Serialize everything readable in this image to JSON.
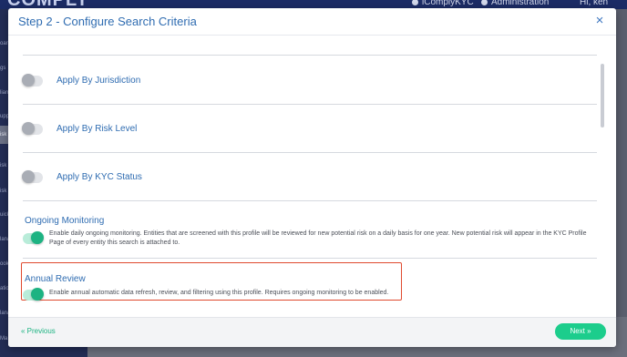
{
  "app": {
    "brand": "COMPLY",
    "org": "iComplyKYC",
    "admin": "Administration",
    "user": "Hi, ken"
  },
  "nav": {
    "items": [
      "oar",
      "gs",
      "lian",
      "upp",
      "isk S",
      "isk",
      "isk",
      "uick",
      "lana",
      "ook",
      "atio",
      "lana",
      "Ma"
    ]
  },
  "modal": {
    "title": "Step 2 - Configure Search Criteria",
    "close_glyph": "×",
    "toggles": [
      {
        "label": "Apply By Jurisdiction",
        "on": false
      },
      {
        "label": "Apply By Risk Level",
        "on": false
      },
      {
        "label": "Apply By KYC Status",
        "on": false
      }
    ],
    "ongoing": {
      "title": "Ongoing Monitoring",
      "on": true,
      "description_line1": "Enable daily ongoing monitoring. Entities that are screened with this profile will be reviewed for new potential risk on a daily basis for one year. New potential risk will appear in the KYC Profile",
      "description_line2": "Page of every entity this search is attached to."
    },
    "annual": {
      "title": "Annual Review",
      "on": true,
      "description": "Enable annual automatic data refresh, review, and filtering using this profile. Requires ongoing monitoring to be enabled."
    },
    "footer": {
      "previous_label": "« Previous",
      "next_label": "Next »"
    }
  },
  "colors": {
    "accent": "#2f6cb1",
    "toggle_on": "#1db382",
    "next_button": "#1ccd8c",
    "highlight": "#e04a2f"
  }
}
